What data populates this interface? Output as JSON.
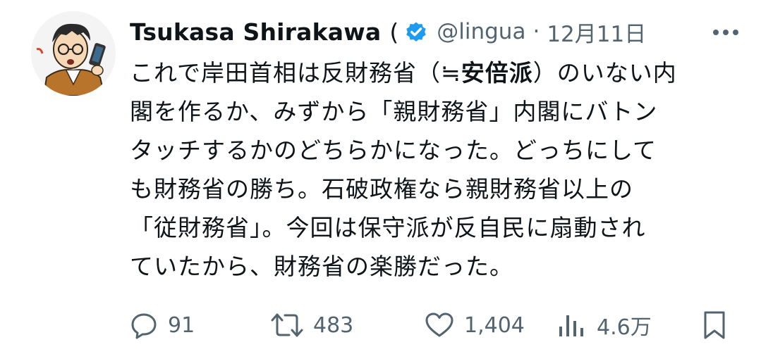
{
  "tweet": {
    "author_name": "Tsukasa Shirakawa",
    "name_suffix": "(",
    "handle": "@lingua",
    "separator": "·",
    "date": "12月11日",
    "body_lines": [
      {
        "before": "これで岸田首相は反財務省（≒",
        "bold": "安倍派",
        "after": "）のいない内"
      },
      {
        "text": "閣を作るか、みずから「親財務省」内閣にバトン"
      },
      {
        "text": "タッチするかのどちらかになった。どっちにして"
      },
      {
        "text": "も財務省の勝ち。石破政権なら親財務省以上の"
      },
      {
        "text": "「従財務省」。今回は保守派が反自民に扇動され"
      },
      {
        "text": "ていたから、財務省の楽勝だった。"
      }
    ]
  },
  "actions": {
    "replies": "91",
    "retweets": "483",
    "likes": "1,404",
    "views": "4.6万"
  },
  "icons": {
    "reply": "speech-bubble-icon",
    "retweet": "retweet-arrows-icon",
    "like": "heart-icon",
    "views": "bar-chart-icon",
    "bookmark": "bookmark-icon",
    "more": "more-dots-icon",
    "verified": "verified-badge-icon"
  },
  "colors": {
    "text": "#0f1419",
    "secondary": "#536471",
    "verified": "#1d9bf0"
  }
}
